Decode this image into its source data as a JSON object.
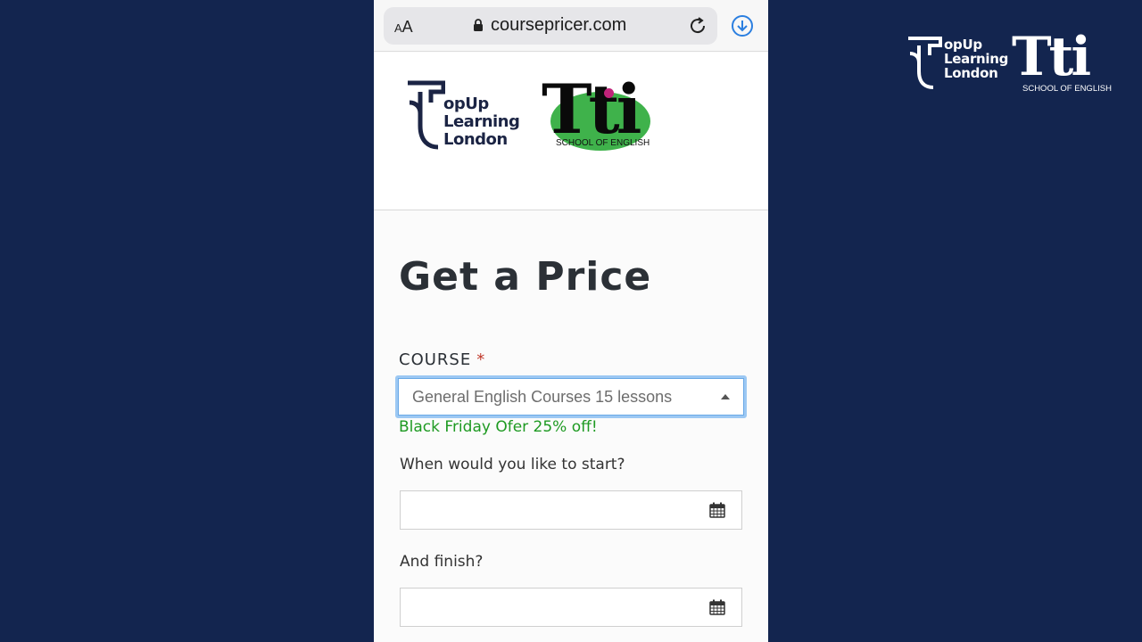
{
  "watermark": {
    "topup_lines": [
      "opUp",
      "Learning",
      "London"
    ],
    "tti_letters": "Tti",
    "tti_tagline": "SCHOOL OF ENGLISH"
  },
  "browser": {
    "text_size_big": "A",
    "text_size_small": "A",
    "url": "coursepricer.com",
    "icons": [
      "lock-icon",
      "reload-icon",
      "download-icon"
    ]
  },
  "logos": {
    "topup_lines": [
      "opUp",
      "Learning",
      "London"
    ],
    "tti_letters": "Tti",
    "tti_tagline": "SCHOOL OF ENGLISH"
  },
  "form": {
    "title": "Get a Price",
    "course_label": "COURSE",
    "required_mark": "*",
    "course_value": "General English Courses 15 lessons",
    "promo": "Black Friday Ofer 25% off!",
    "start_label": "When would you like to start?",
    "start_value": "",
    "finish_label": "And finish?",
    "finish_value": "",
    "icons": [
      "calendar-icon",
      "chevron-up-icon"
    ]
  },
  "colors": {
    "background": "#13254f",
    "promo_green": "#1e9a22",
    "required_red": "#c0392b",
    "focus_blue": "#9cc8f3",
    "tti_green": "#3fb24b",
    "tti_magenta": "#c0237a",
    "download_blue": "#2b7fe0"
  }
}
